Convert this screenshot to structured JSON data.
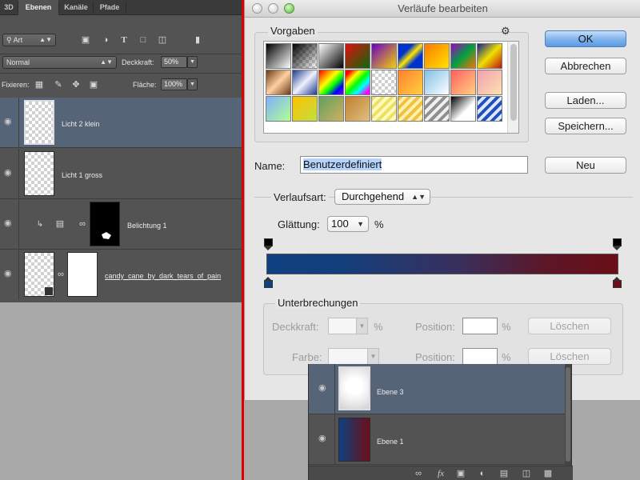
{
  "layers_panel": {
    "tabs": [
      {
        "label": "3D"
      },
      {
        "label": "Ebenen",
        "active": true
      },
      {
        "label": "Kanäle"
      },
      {
        "label": "Pfade"
      }
    ],
    "filter": {
      "label": "Art",
      "icon": "search-icon"
    },
    "filter_icons": [
      "image-filter-icon",
      "adjustment-filter-icon",
      "text-filter-icon",
      "shape-filter-icon",
      "smart-object-filter-icon",
      "filter-toggle-icon"
    ],
    "blend_mode": "Normal",
    "opacity_label": "Deckkraft:",
    "opacity_value": "50%",
    "lock_label": "Fixieren:",
    "fill_label": "Fläche:",
    "fill_value": "100%",
    "layers": [
      {
        "name": "Licht 2 klein",
        "selected": true
      },
      {
        "name": "Licht 1 gross"
      },
      {
        "name": "Belichtung 1"
      },
      {
        "name": "candy_cane_by_dark_tears_of_pain"
      }
    ]
  },
  "dialog": {
    "title": "Verläufe bearbeiten",
    "presets_label": "Vorgaben",
    "buttons": {
      "ok": "OK",
      "cancel": "Abbrechen",
      "load": "Laden...",
      "save": "Speichern...",
      "new": "Neu"
    },
    "name_label": "Name:",
    "name_value": "Benutzerdefiniert",
    "type_label": "Verlaufsart:",
    "type_value": "Durchgehend",
    "smoothness_label": "Glättung:",
    "smoothness_value": "100",
    "smoothness_unit": "%",
    "gradient_colors": {
      "left": "#0f4080",
      "right": "#6b0e17"
    },
    "stops_group_label": "Unterbrechungen",
    "stops": {
      "opacity_label": "Deckkraft:",
      "opacity_unit": "%",
      "color_label": "Farbe:",
      "position_label_1": "Position:",
      "position_unit_1": "%",
      "position_label_2": "Position:",
      "position_unit_2": "%",
      "delete_1": "Löschen",
      "delete_2": "Löschen"
    }
  },
  "floating_layers": {
    "layers": [
      {
        "name": "Ebene 3",
        "selected": true
      },
      {
        "name": "Ebene 1"
      }
    ],
    "bottom_icons": [
      "link-layers-icon",
      "fx-icon",
      "mask-icon",
      "adjustment-layer-icon",
      "group-folder-icon",
      "new-layer-icon",
      "trash-icon"
    ]
  }
}
